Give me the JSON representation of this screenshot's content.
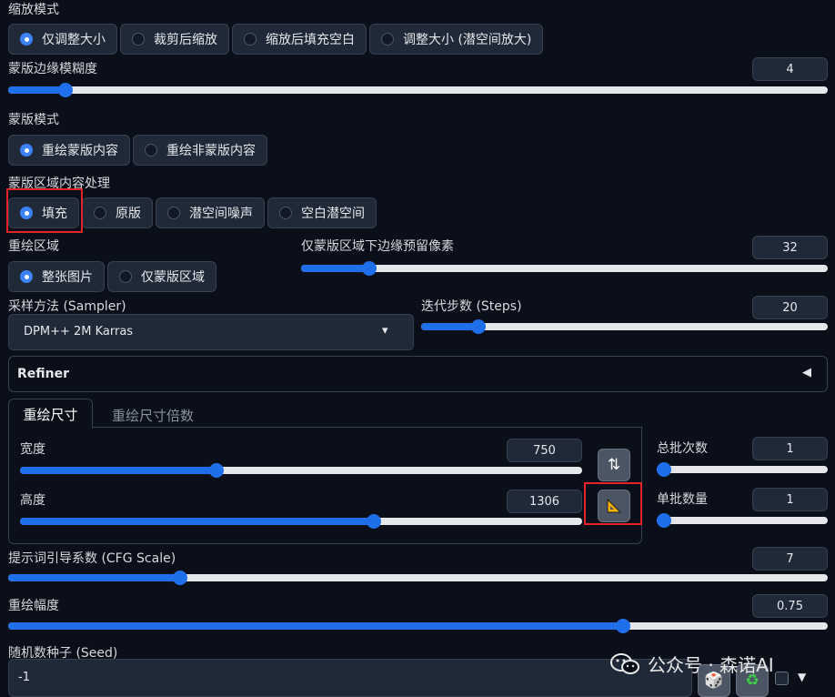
{
  "resize_mode": {
    "label": "缩放模式",
    "options": [
      "仅调整大小",
      "裁剪后缩放",
      "缩放后填充空白",
      "调整大小 (潜空间放大)"
    ],
    "selected": 0
  },
  "mask_blur": {
    "label": "蒙版边缘模糊度",
    "value": "4",
    "fraction": 0.07
  },
  "mask_mode": {
    "label": "蒙版模式",
    "options": [
      "重绘蒙版内容",
      "重绘非蒙版内容"
    ],
    "selected": 0
  },
  "masked_content": {
    "label": "蒙版区域内容处理",
    "options": [
      "填充",
      "原版",
      "潜空间噪声",
      "空白潜空间"
    ],
    "selected": 0
  },
  "inpaint_area": {
    "label": "重绘区域",
    "options": [
      "整张图片",
      "仅蒙版区域"
    ],
    "selected": 0
  },
  "only_masked_padding": {
    "label": "仅蒙版区域下边缘预留像素",
    "value": "32",
    "fraction": 0.13
  },
  "sampler": {
    "label": "采样方法 (Sampler)",
    "value": "DPM++ 2M Karras",
    "arrow": "▾"
  },
  "steps": {
    "label": "迭代步数 (Steps)",
    "value": "20",
    "fraction": 0.14
  },
  "refiner": {
    "label": "Refiner",
    "arrow": "◀"
  },
  "size_tabs": {
    "tabs": [
      "重绘尺寸",
      "重绘尺寸倍数"
    ],
    "active": 0
  },
  "width": {
    "label": "宽度",
    "value": "750",
    "fraction": 0.35
  },
  "height": {
    "label": "高度",
    "value": "1306",
    "fraction": 0.63
  },
  "swap_icon": "⇅",
  "batch_count": {
    "label": "总批次数",
    "value": "1",
    "fraction": 0.0
  },
  "batch_size": {
    "label": "单批数量",
    "value": "1",
    "fraction": 0.0
  },
  "cfg": {
    "label": "提示词引导系数 (CFG Scale)",
    "value": "7",
    "fraction": 0.21
  },
  "denoise": {
    "label": "重绘幅度",
    "value": "0.75",
    "fraction": 0.75
  },
  "seed": {
    "label": "随机数种子 (Seed)",
    "value": "-1",
    "dice_icon": "🎲",
    "recycle_icon": "♻",
    "more_arrow": "▼"
  },
  "watermark": {
    "text": "公众号 · 森诺AI"
  },
  "colors": {
    "accent": "#1f6feb",
    "background": "#0b0f19",
    "highlight": "#e3242b"
  }
}
